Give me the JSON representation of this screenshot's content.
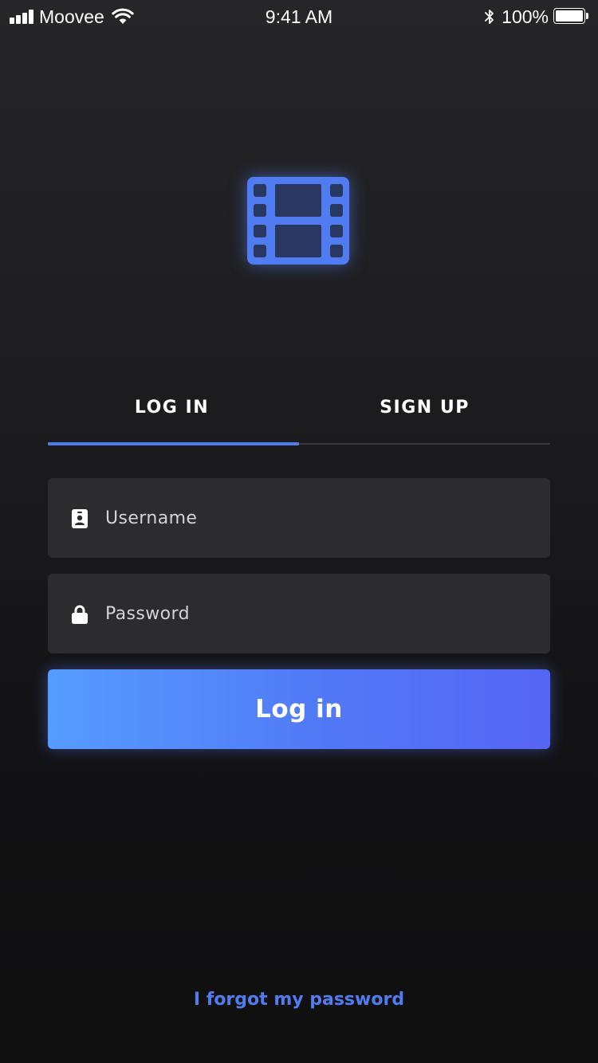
{
  "status_bar": {
    "carrier": "Moovee",
    "time": "9:41 AM",
    "battery": "100%",
    "icons": [
      "signal-icon",
      "wifi-icon",
      "bluetooth-icon",
      "battery-icon"
    ]
  },
  "logo": {
    "icon": "film-icon",
    "color": "#4f7cf0"
  },
  "tabs": [
    {
      "label": "LOG IN",
      "active": true
    },
    {
      "label": "SIGN UP",
      "active": false
    }
  ],
  "form": {
    "username": {
      "placeholder": "Username",
      "value": "",
      "icon": "id-badge-icon"
    },
    "password": {
      "placeholder": "Password",
      "value": "",
      "icon": "lock-icon"
    },
    "submit_label": "Log in"
  },
  "forgot_password": "I forgot my password",
  "colors": {
    "accent": "#4f7cf0",
    "button_gradient_start": "#569cff",
    "button_gradient_end": "#5665f4",
    "field_background": "#2c2c2f",
    "background": "#1a1a1c"
  }
}
